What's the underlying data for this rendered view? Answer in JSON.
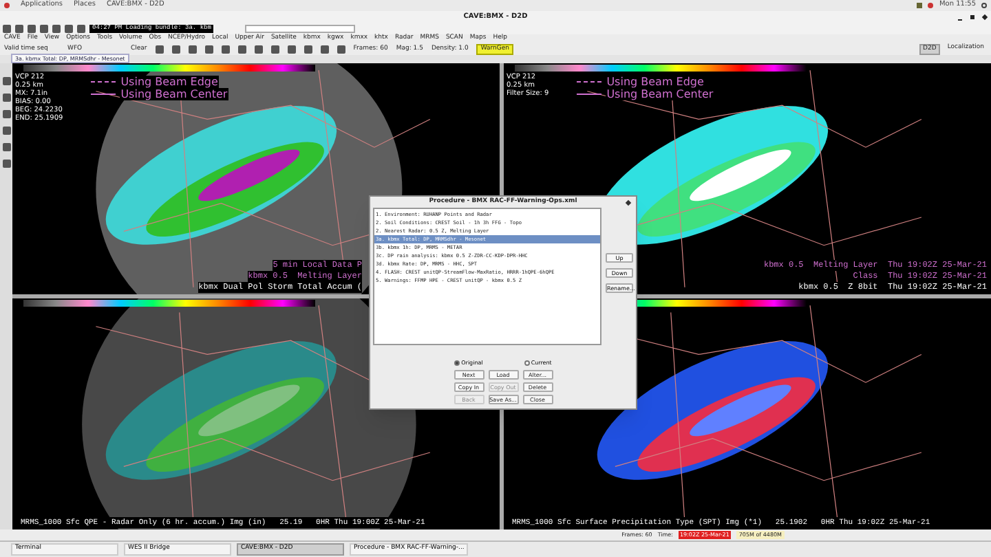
{
  "system_bar": {
    "menus": [
      "Applications",
      "Places"
    ],
    "app": "CAVE:BMX - D2D",
    "clock": "Mon 11:55"
  },
  "window": {
    "title": "CAVE:BMX - D2D"
  },
  "loading": {
    "text": "04:27 PM Loading bundle: 3a. kbm"
  },
  "menu": [
    "CAVE",
    "File",
    "View",
    "Options",
    "Tools",
    "Volume",
    "Obs",
    "NCEP/Hydro",
    "Local",
    "Upper Air",
    "Satellite",
    "kbmx",
    "kgwx",
    "kmxx",
    "khtx",
    "Radar",
    "MRMS",
    "SCAN",
    "Maps",
    "Help"
  ],
  "toolbar": {
    "time_mode": "Valid time seq",
    "scale": "WFO",
    "clear": "Clear",
    "frames": "Frames: 60",
    "mag": "Mag: 1.5",
    "density": "Density: 1.0",
    "warngen": "WarnGen",
    "perspectives": [
      {
        "label": "D2D",
        "selected": true
      },
      {
        "label": "Localization",
        "selected": false
      }
    ]
  },
  "editor_tab": {
    "label": "3a. kbmx Total: DP, MRMSdhr - Mesonet"
  },
  "panels": [
    {
      "info": [
        "VCP 212",
        "0.25 km",
        "MX: 7.1in",
        "BIAS: 0.00",
        "BEG: 24.2230",
        "END: 25.1909"
      ],
      "legend": [
        "Using Beam Edge",
        "Using Beam Center"
      ],
      "labels": [
        "5 min Local Data P",
        "kbmx 0.5  Melting Layer",
        "kbmx Dual Pol Storm Total Accum ("
      ]
    },
    {
      "info": [
        "VCP 212",
        "0.25 km",
        "Filter Size: 9"
      ],
      "legend": [
        "Using Beam Edge",
        "Using Beam Center"
      ],
      "labels": [
        "kbmx 0.5  Melting Layer  Thu 19:02Z 25-Mar-21",
        "Class  Thu 19:02Z 25-Mar-21",
        "kbmx 0.5  Z 8bit  Thu 19:02Z 25-Mar-21"
      ]
    },
    {
      "labels": [
        "MRMS_1000 Sfc QPE - Radar Only (6 hr. accum.) Img (in)   25.19   0HR Thu 19:00Z 25-Mar-21"
      ]
    },
    {
      "labels": [
        "MRMS_1000 Sfc Surface Precipitation Type (SPT) Img (*1)   25.1902   0HR Thu 19:02Z 25-Mar-21"
      ]
    }
  ],
  "procedure": {
    "title": "Procedure - BMX RAC-FF-Warning-Ops.xml",
    "items": [
      {
        "label": "1. Environment: RUHANP Points and Radar",
        "selected": false
      },
      {
        "label": "2. Soil Conditions: CREST Soil - 1h 3h FFG - Topo",
        "selected": false
      },
      {
        "label": "2. Nearest Radar: 0.5 Z, Melting Layer",
        "selected": false
      },
      {
        "label": "3a. kbmx Total: DP, MRMSdhr - Mesonet",
        "selected": true
      },
      {
        "label": "3b. kbmx 1h: DP, MRMS - METAR",
        "selected": false
      },
      {
        "label": "3c. DP rain analysis: kbmx 0.5 Z-ZDR-CC-KDP-DPR-HHC",
        "selected": false
      },
      {
        "label": "3d. kbmx Rate: DP, MRMS - HHC, SPT",
        "selected": false
      },
      {
        "label": "4. FLASH: CREST unitQP-StreamFlow-MaxRatio, HRRR-1hQPE-6hQPE",
        "selected": false
      },
      {
        "label": "5. Warnings: FFMP HPE - CREST unitQP - kbmx 0.5 Z",
        "selected": false
      }
    ],
    "side_buttons": [
      "Up",
      "Down",
      "Rename..."
    ],
    "radios": [
      {
        "label": "Original",
        "selected": true
      },
      {
        "label": "Current",
        "selected": false
      }
    ],
    "buttons": [
      {
        "label": "Next",
        "disabled": false
      },
      {
        "label": "Load",
        "disabled": false
      },
      {
        "label": "Alter...",
        "disabled": false
      },
      {
        "label": "Copy In",
        "disabled": false
      },
      {
        "label": "Copy Out",
        "disabled": true
      },
      {
        "label": "Delete",
        "disabled": false
      },
      {
        "label": "Back",
        "disabled": true
      },
      {
        "label": "Save As...",
        "disabled": false
      },
      {
        "label": "Close",
        "disabled": false
      }
    ]
  },
  "status": {
    "frames": "Frames: 60",
    "time_label": "Time:",
    "time": "19:02Z 25-Mar-21",
    "memory": "705M of 4480M"
  },
  "taskbar": [
    {
      "label": "Terminal",
      "selected": false
    },
    {
      "label": "WES II Bridge",
      "selected": false
    },
    {
      "label": "CAVE:BMX - D2D",
      "selected": true
    },
    {
      "label": "Procedure - BMX RAC-FF-Warning-...",
      "selected": false
    }
  ]
}
